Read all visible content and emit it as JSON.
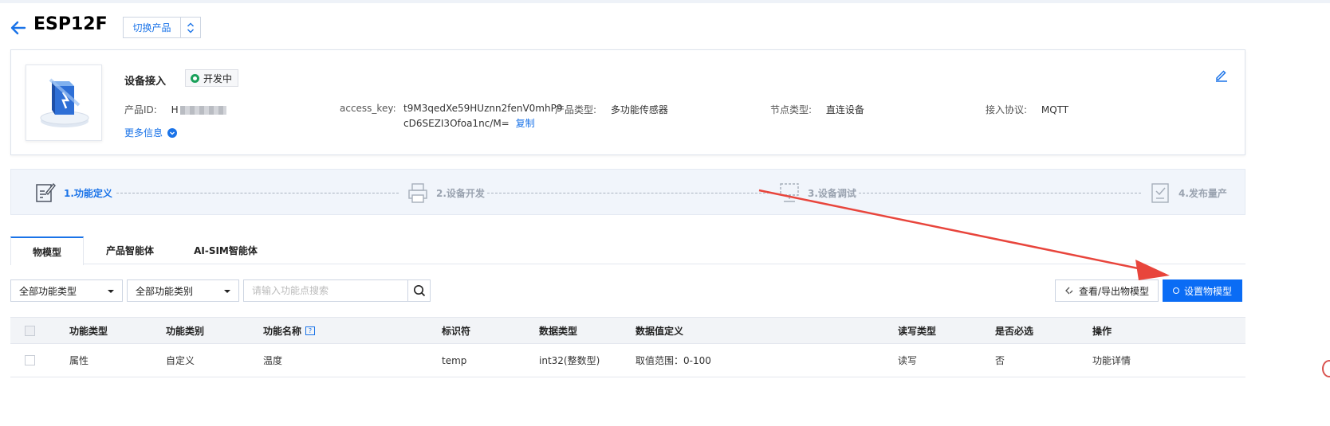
{
  "header": {
    "title": "ESP12F",
    "switch_label": "切换产品"
  },
  "product": {
    "section_label": "设备接入",
    "status": "开发中",
    "status_color": "#1aa05a",
    "product_id_key": "产品ID:",
    "product_id_value": "H",
    "access_key_key": "access_key:",
    "access_key_line1": "t9M3qedXe59HUznn2fenV0mhP9",
    "access_key_line2": "cD6SEZI3Ofoa1nc/M=",
    "copy_label": "复制",
    "type_key": "产品类型:",
    "type_value": "多功能传感器",
    "node_key": "节点类型:",
    "node_value": "直连设备",
    "protocol_key": "接入协议:",
    "protocol_value": "MQTT",
    "more_label": "更多信息"
  },
  "steps": [
    {
      "label": "1.功能定义",
      "active": true
    },
    {
      "label": "2.设备开发",
      "active": false
    },
    {
      "label": "3.设备调试",
      "active": false
    },
    {
      "label": "4.发布量产",
      "active": false
    }
  ],
  "tabs": [
    "物模型",
    "产品智能体",
    "AI-SIM智能体"
  ],
  "filters": {
    "type_select": "全部功能类型",
    "category_select": "全部功能类别",
    "search_placeholder": "请输入功能点搜索"
  },
  "actions": {
    "view_export": "查看/导出物模型",
    "set_model": "设置物模型"
  },
  "table": {
    "headers": [
      "功能类型",
      "功能类别",
      "功能名称",
      "标识符",
      "数据类型",
      "数据值定义",
      "读写类型",
      "是否必选",
      "操作"
    ],
    "help_mark": "?",
    "rows": [
      [
        "属性",
        "自定义",
        "温度",
        "temp",
        "int32(整数型)",
        "取值范围：0-100",
        "读写",
        "否",
        "功能详情"
      ]
    ]
  },
  "colors": {
    "accent": "#1a73e8",
    "primary_button": "#0a6cf5",
    "annotation_arrow": "#e8453c"
  }
}
